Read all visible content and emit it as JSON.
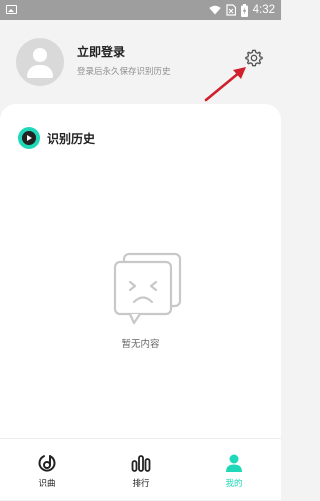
{
  "status_bar": {
    "time": "4:32"
  },
  "header": {
    "login_title": "立即登录",
    "login_subtitle": "登录后永久保存识别历史"
  },
  "history": {
    "title": "识别历史",
    "empty_text": "暂无内容"
  },
  "bottom_nav": {
    "items": [
      {
        "label": "识曲",
        "icon": "music-recognize-icon"
      },
      {
        "label": "排行",
        "icon": "ranking-bars-icon"
      },
      {
        "label": "我的",
        "icon": "profile-icon",
        "active": true
      }
    ]
  },
  "colors": {
    "accent": "#1ed8b7",
    "annotation_arrow": "#d0202e",
    "status_bar": "#9e9e9e"
  }
}
